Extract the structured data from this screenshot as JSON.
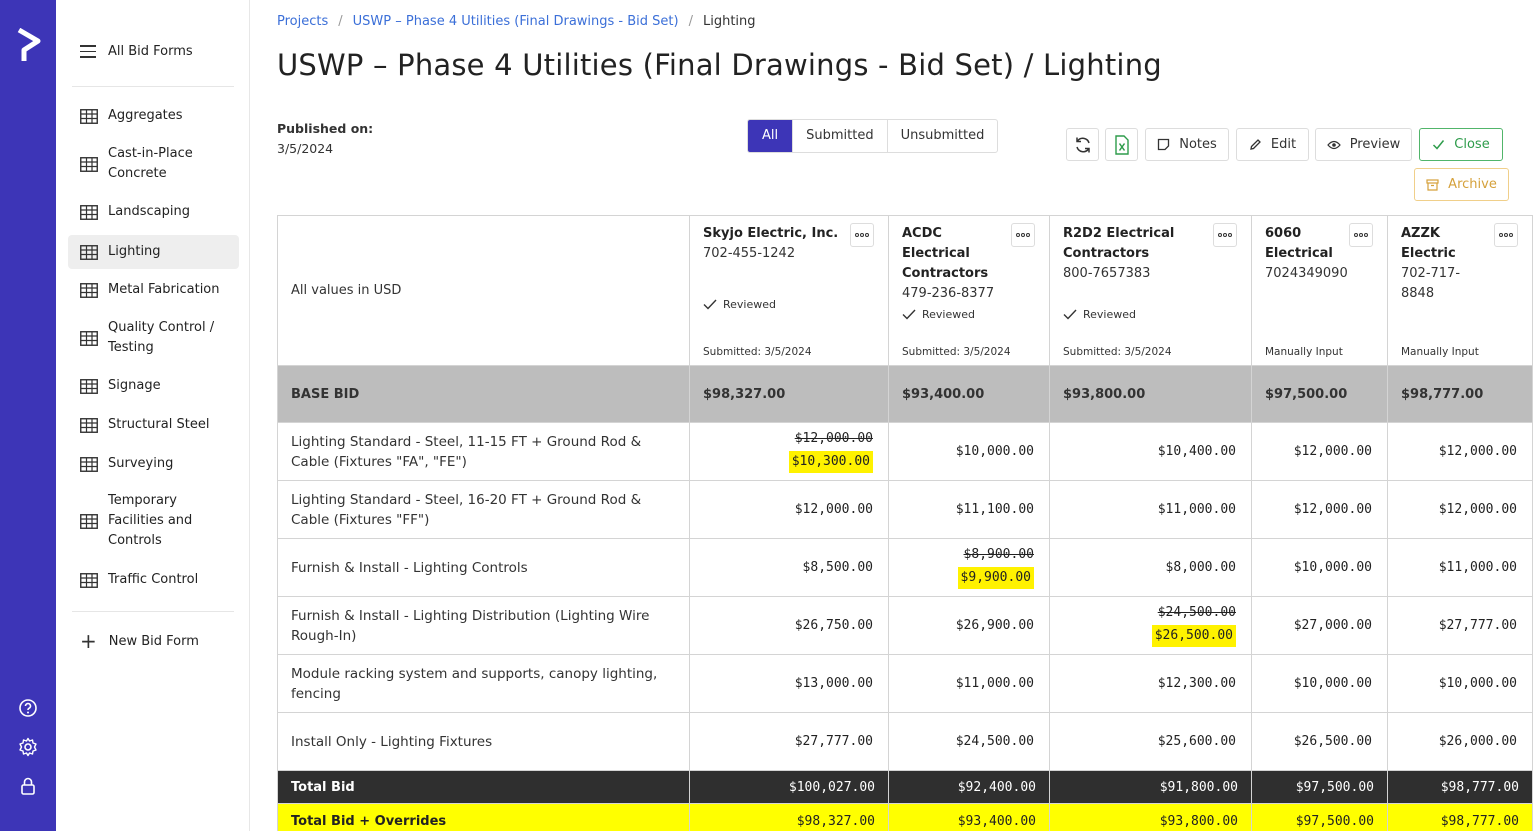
{
  "sidebar": {
    "all_label": "All Bid Forms",
    "items": [
      {
        "label": "Aggregates"
      },
      {
        "label": "Cast-in-Place Concrete"
      },
      {
        "label": "Landscaping"
      },
      {
        "label": "Lighting"
      },
      {
        "label": "Metal Fabrication"
      },
      {
        "label": "Quality Control / Testing"
      },
      {
        "label": "Signage"
      },
      {
        "label": "Structural Steel"
      },
      {
        "label": "Surveying"
      },
      {
        "label": "Temporary Facilities and Controls"
      },
      {
        "label": "Traffic Control"
      }
    ],
    "new_label": "New Bid Form"
  },
  "breadcrumb": [
    "Projects",
    "USWP – Phase 4 Utilities (Final Drawings - Bid Set)",
    "Lighting"
  ],
  "title": "USWP – Phase 4 Utilities (Final Drawings - Bid Set) / Lighting",
  "published": {
    "label": "Published on:",
    "date": "3/5/2024"
  },
  "filters": [
    "All",
    "Submitted",
    "Unsubmitted"
  ],
  "toolbar": {
    "notes": "Notes",
    "edit": "Edit",
    "preview": "Preview",
    "close": "Close",
    "archive": "Archive"
  },
  "table": {
    "header_label": "All values in USD",
    "vendors": [
      {
        "name": "Skyjo Electric, Inc.",
        "phone": "702-455-1242",
        "reviewed": "Reviewed",
        "footer": "Submitted: 3/5/2024"
      },
      {
        "name": "ACDC Electrical Contractors",
        "phone": "479-236-8377",
        "reviewed": "Reviewed",
        "footer": "Submitted: 3/5/2024"
      },
      {
        "name": "R2D2 Electrical Contractors",
        "phone": "800-7657383",
        "reviewed": "Reviewed",
        "footer": "Submitted: 3/5/2024"
      },
      {
        "name": "6060 Electrical",
        "phone": "7024349090",
        "reviewed": "",
        "footer": "Manually Input"
      },
      {
        "name": "AZZK Electric",
        "phone": "702-717-8848",
        "reviewed": "",
        "footer": "Manually Input"
      }
    ],
    "base_bid": {
      "label": "BASE BID",
      "values": [
        "$98,327.00",
        "$93,400.00",
        "$93,800.00",
        "$97,500.00",
        "$98,777.00"
      ]
    },
    "rows": [
      {
        "desc": "Lighting Standard - Steel, 11-15 FT + Ground Rod & Cable (Fixtures \"FA\", \"FE\")",
        "cells": [
          {
            "orig": "$12,000.00",
            "value": "$10,300.00"
          },
          {
            "value": "$10,000.00"
          },
          {
            "value": "$10,400.00"
          },
          {
            "value": "$12,000.00"
          },
          {
            "value": "$12,000.00"
          }
        ]
      },
      {
        "desc": "Lighting Standard - Steel, 16-20 FT + Ground Rod & Cable (Fixtures \"FF\")",
        "cells": [
          {
            "value": "$12,000.00"
          },
          {
            "value": "$11,100.00"
          },
          {
            "value": "$11,000.00"
          },
          {
            "value": "$12,000.00"
          },
          {
            "value": "$12,000.00"
          }
        ]
      },
      {
        "desc": "Furnish & Install - Lighting Controls",
        "cells": [
          {
            "value": "$8,500.00"
          },
          {
            "orig": "$8,900.00",
            "value": "$9,900.00"
          },
          {
            "value": "$8,000.00"
          },
          {
            "value": "$10,000.00"
          },
          {
            "value": "$11,000.00"
          }
        ]
      },
      {
        "desc": "Furnish & Install - Lighting Distribution (Lighting Wire Rough-In)",
        "cells": [
          {
            "value": "$26,750.00"
          },
          {
            "value": "$26,900.00"
          },
          {
            "orig": "$24,500.00",
            "value": "$26,500.00"
          },
          {
            "value": "$27,000.00"
          },
          {
            "value": "$27,777.00"
          }
        ]
      },
      {
        "desc": "Module racking system and supports, canopy lighting, fencing",
        "cells": [
          {
            "value": "$13,000.00"
          },
          {
            "value": "$11,000.00"
          },
          {
            "value": "$12,300.00"
          },
          {
            "value": "$10,000.00"
          },
          {
            "value": "$10,000.00"
          }
        ]
      },
      {
        "desc": "Install Only - Lighting Fixtures",
        "cells": [
          {
            "value": "$27,777.00"
          },
          {
            "value": "$24,500.00"
          },
          {
            "value": "$25,600.00"
          },
          {
            "value": "$26,500.00"
          },
          {
            "value": "$26,000.00"
          }
        ]
      }
    ],
    "total": {
      "label": "Total Bid",
      "values": [
        "$100,027.00",
        "$92,400.00",
        "$91,800.00",
        "$97,500.00",
        "$98,777.00"
      ]
    },
    "total_overrides": {
      "label": "Total Bid + Overrides",
      "values": [
        "$98,327.00",
        "$93,400.00",
        "$93,800.00",
        "$97,500.00",
        "$98,777.00"
      ]
    }
  },
  "colors": {
    "rail": "#3d35b7",
    "highlight": "#fff200",
    "total_row": "#2f2f2f",
    "override_row": "#ffff00"
  }
}
